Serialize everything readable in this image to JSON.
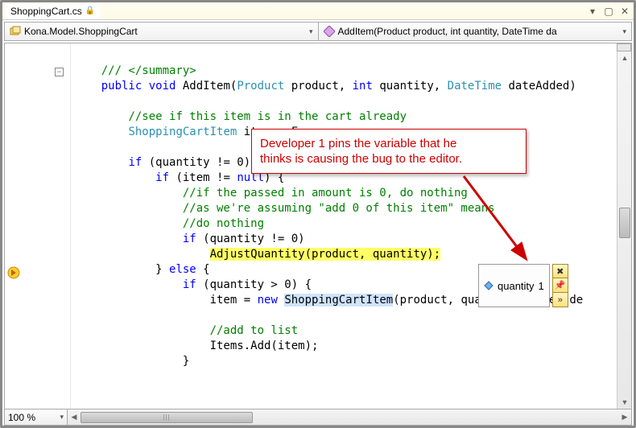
{
  "titlebar": {
    "filename": "ShoppingCart.cs"
  },
  "navbar": {
    "class": "Kona.Model.ShoppingCart",
    "member": "AddItem(Product product, int quantity, DateTime da"
  },
  "zoom": {
    "level": "100 %"
  },
  "callout": {
    "line1": "Developer 1 pins the variable that he",
    "line2": "thinks is causing the bug to the editor."
  },
  "datatip": {
    "name": "quantity",
    "value": "1"
  },
  "code": {
    "l1a": "/// </summary>",
    "l2_kw1": "public",
    "l2_kw2": "void",
    "l2_name": " AddItem(",
    "l2_t1": "Product",
    "l2_p1": " product, ",
    "l2_kw3": "int",
    "l2_p2": " quantity, ",
    "l2_t2": "DateTime",
    "l2_p3": " dateAdded)",
    "l4c": "//see if this item is in the cart already",
    "l5t": "ShoppingCartItem",
    "l5r": " item = F",
    "l7_kw": "if",
    "l7_r": " (quantity != 0) {",
    "l8_kw": "if",
    "l8_r": " (item != ",
    "l8_kw2": "null",
    "l8_r2": ") {",
    "l9c": "//if the passed in amount is 0, do nothing",
    "l10c": "//as we're assuming \"add 0 of this item\" means",
    "l11c": "//do nothing",
    "l12_kw": "if",
    "l12_r": " (quantity != 0)",
    "l13": "AdjustQuantity(product, quantity);",
    "l14_r1": "} ",
    "l14_kw": "else",
    "l14_r2": " {",
    "l15_kw": "if",
    "l15_r": " (quantity > 0) {",
    "l16_r1": "item = ",
    "l16_kw": "new",
    "l16_sp": " ",
    "l16_sel": "ShoppingCartItem",
    "l16_r2": "(product, quantity, dateAdde",
    "l18c": "//add to list",
    "l19": "Items.Add(item);",
    "l20": "}"
  }
}
